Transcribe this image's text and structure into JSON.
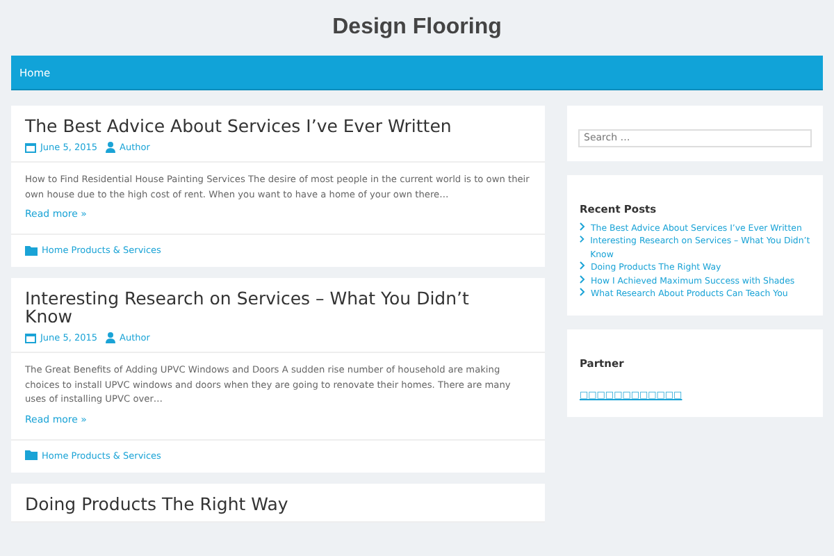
{
  "site_title": "Design Flooring",
  "nav": [
    {
      "label": "Home",
      "selected": true
    }
  ],
  "posts": [
    {
      "title": "The Best Advice About Services I’ve Ever Written",
      "date": "June 5, 2015",
      "author": "Author",
      "excerpt": "How to Find Residential House Painting Services The desire of most people in the current world is to own their own house due to the high cost of rent. When you want to have a home of your own there…",
      "read_more": "Read more »",
      "category": "Home Products & Services"
    },
    {
      "title": "Interesting Research on Services – What You Didn’t Know",
      "date": "June 5, 2015",
      "author": "Author",
      "excerpt": "The Great Benefits of Adding UPVC Windows and Doors A sudden rise number of household are making choices to install UPVC windows and doors when they are going to renovate their homes. There are many uses of installing UPVC over…",
      "read_more": "Read more »",
      "category": "Home Products & Services"
    },
    {
      "title": "Doing Products The Right Way"
    }
  ],
  "sidebar": {
    "search": {
      "placeholder": "Search …"
    },
    "recent_posts": {
      "heading": "Recent Posts",
      "items": [
        "The Best Advice About Services I’ve Ever Written",
        "Interesting Research on Services – What You Didn’t Know",
        "Doing Products The Right Way",
        "How I Achieved Maximum Success with Shades",
        "What Research About Products Can Teach You"
      ]
    },
    "partner": {
      "heading": "Partner",
      "link": "□□□□□□□□□□□□"
    }
  }
}
